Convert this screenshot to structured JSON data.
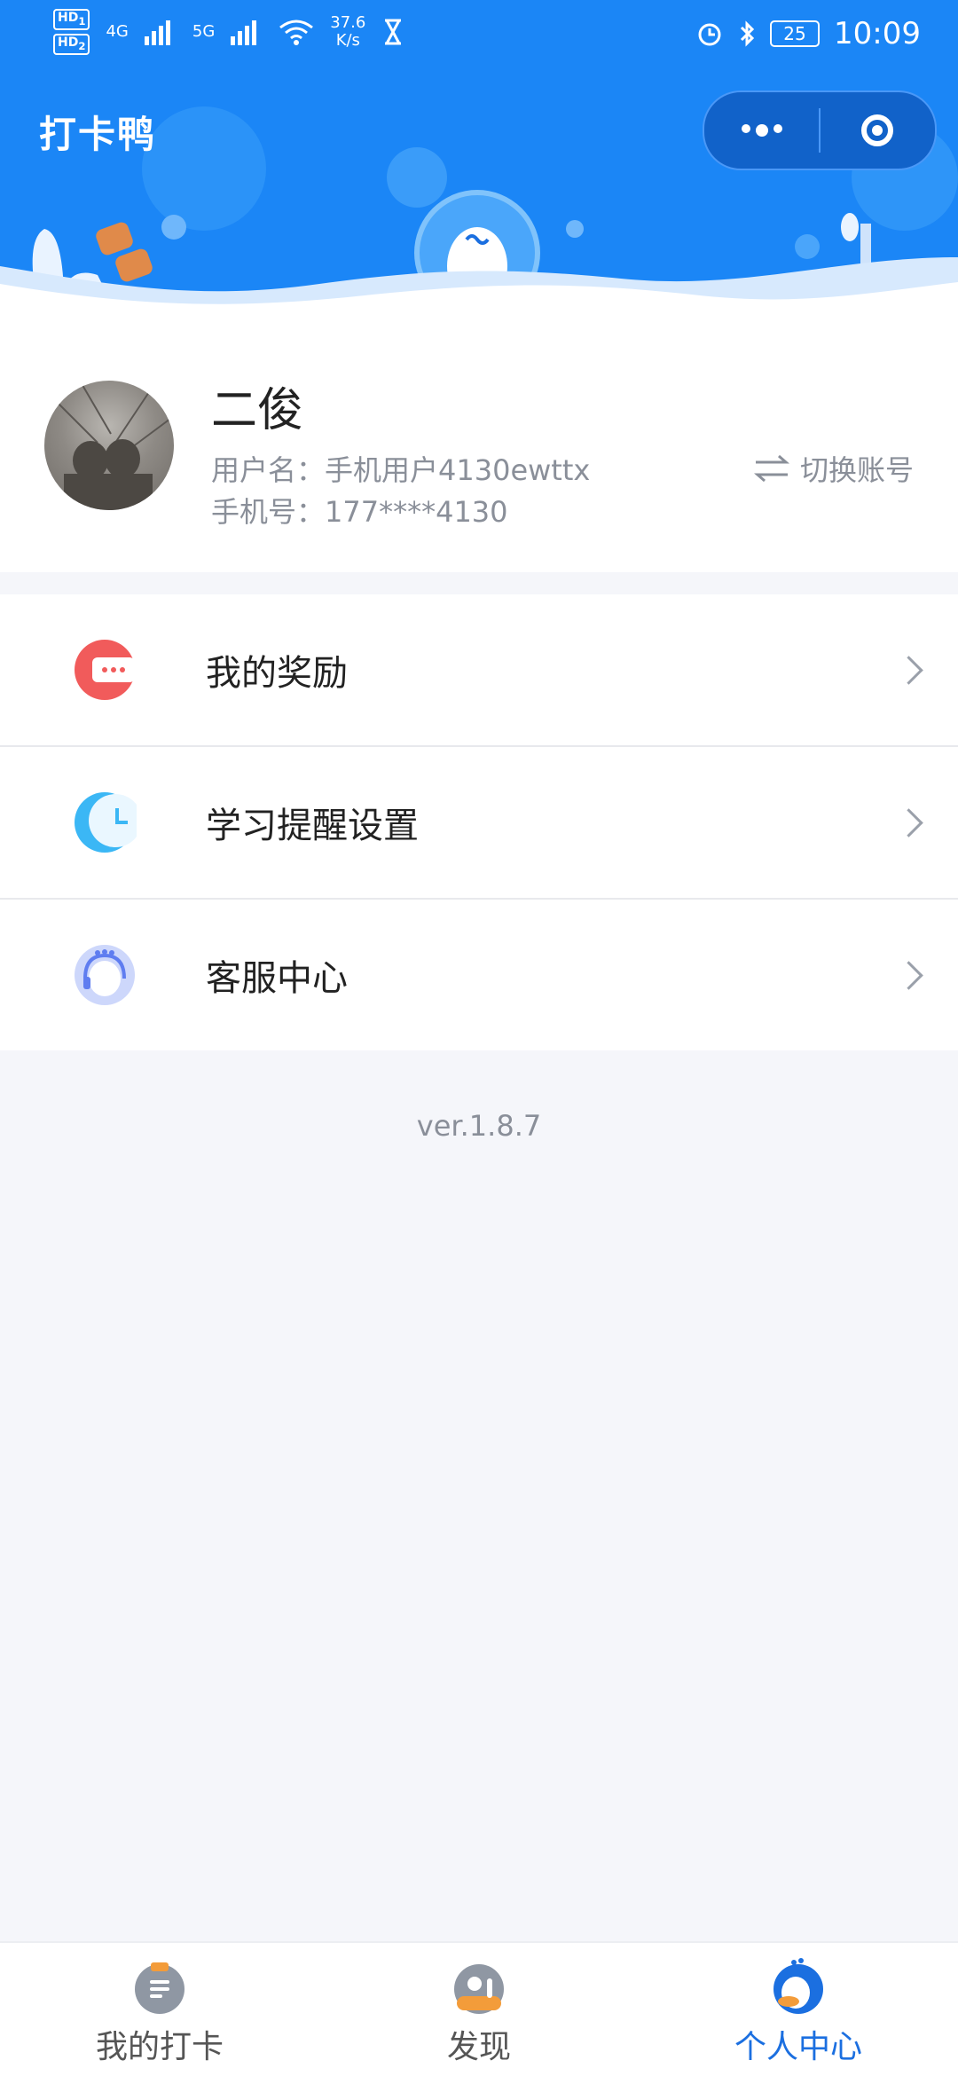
{
  "status_bar": {
    "hd1": "HD",
    "hd1_sub": "1",
    "hd2": "HD",
    "hd2_sub": "2",
    "net1": "4G",
    "net2": "5G",
    "speed_value": "37.6",
    "speed_unit": "K/s",
    "battery": "25",
    "time": "10:09"
  },
  "header": {
    "title": "打卡鸭",
    "capsule_more": "more-dots-icon",
    "capsule_target": "target-icon"
  },
  "profile": {
    "nickname": "二俊",
    "username": "用户名：手机用户4130ewttx",
    "phone": "手机号：177****4130",
    "switch_label": "切换账号"
  },
  "menu": [
    {
      "label": "我的奖励",
      "icon": "reward-icon",
      "color": "#f15b5b"
    },
    {
      "label": "学习提醒设置",
      "icon": "clock-moon-icon",
      "color": "#3bb7f5"
    },
    {
      "label": "客服中心",
      "icon": "customer-service-icon",
      "color": "#5f7df0"
    }
  ],
  "version": "ver.1.8.7",
  "tabs": [
    {
      "label": "我的打卡",
      "active": false
    },
    {
      "label": "发现",
      "active": false
    },
    {
      "label": "个人中心",
      "active": true
    }
  ],
  "colors": {
    "brand_blue": "#1b86f6",
    "active_tab": "#1b6fe0",
    "muted_text": "#8a8f99",
    "page_bg": "#f5f6fa"
  }
}
